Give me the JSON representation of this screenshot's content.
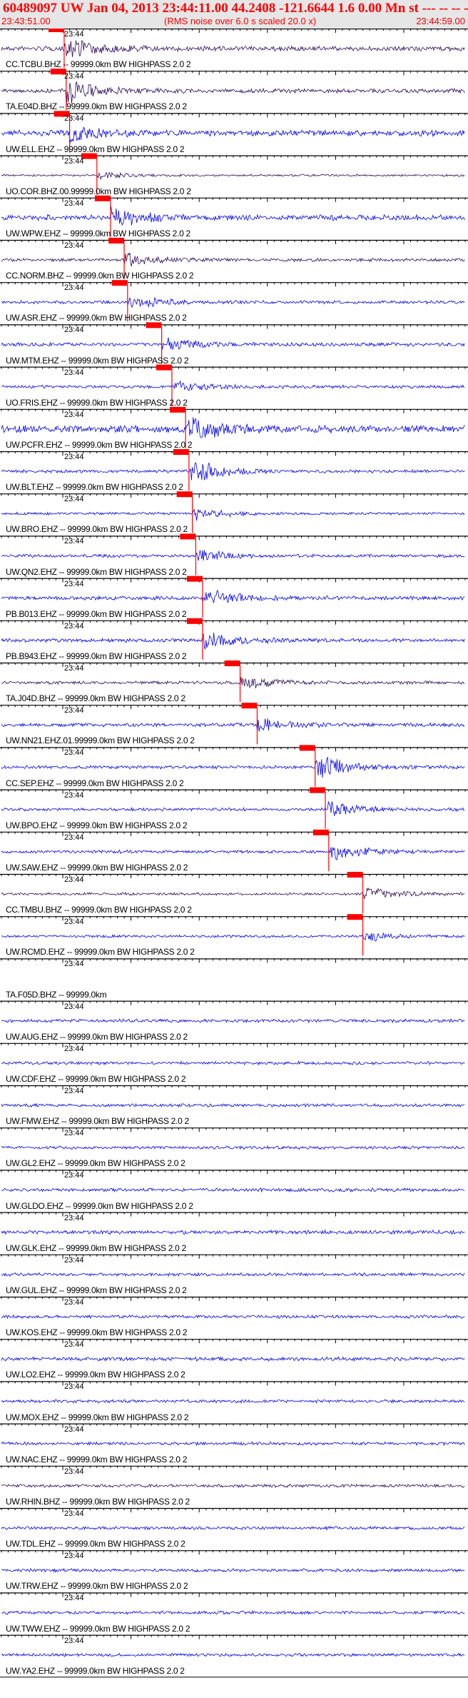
{
  "header": {
    "title": "60489097 UW Jan 04, 2013 23:44:11.00   44.2408 -121.6644  1.6 0.00 Mn st --- -- --   -1",
    "start_time": "23:43:51.00",
    "end_time": "23:44:59.00",
    "note": "(RMS noise over 6.0 s scaled 20.0 x)"
  },
  "chart_data": {
    "type": "line",
    "time_mark": "23:44",
    "duration_s": 68,
    "tick_interval_s": 1,
    "time_mark_s": 9,
    "colors": {
      "blue": "#0000ee",
      "dark": "#2a0a5a",
      "pick": "#ff0000",
      "axis": "#000000",
      "header_bg": "#e6e6e6"
    },
    "traces": [
      {
        "label": "CC.TCBU.BHZ -- 99999.0km BW  HIGHPASS  2.0  2",
        "color": "dark",
        "amp": 0.45,
        "pick_s": 9.2,
        "burst": 0.9
      },
      {
        "label": "TA.E04D.BHZ -- 99999.0km BW  HIGHPASS  2.0  2",
        "color": "dark",
        "amp": 0.4,
        "pick_s": 9.5,
        "burst": 0.9
      },
      {
        "label": "UW.ELL.EHZ -- 99999.0km BW  HIGHPASS  2.0  2",
        "color": "blue",
        "amp": 0.55,
        "pick_s": 10.0,
        "burst": 0.7
      },
      {
        "label": "UO.COR.BHZ.00.99999.0km BW  HIGHPASS  2.0  2",
        "color": "dark",
        "amp": 0.2,
        "pick_s": 14.0,
        "burst": 0.3
      },
      {
        "label": "UW.WPW.EHZ -- 99999.0km BW  HIGHPASS  2.0  2",
        "color": "blue",
        "amp": 0.5,
        "pick_s": 16.0,
        "burst": 0.9
      },
      {
        "label": "CC.NORM.BHZ -- 99999.0km BW  HIGHPASS  2.0  2",
        "color": "dark",
        "amp": 0.3,
        "pick_s": 18.0,
        "burst": 0.6
      },
      {
        "label": "UW.ASR.EHZ -- 99999.0km BW  HIGHPASS  2.0  2",
        "color": "blue",
        "amp": 0.3,
        "pick_s": 18.5,
        "burst": 0.6
      },
      {
        "label": "UW.MTM.EHZ -- 99999.0km BW  HIGHPASS  2.0  2",
        "color": "blue",
        "amp": 0.35,
        "pick_s": 23.5,
        "burst": 0.6
      },
      {
        "label": "UO.FRIS.EHZ -- 99999.0km BW  HIGHPASS  2.0  2",
        "color": "blue",
        "amp": 0.3,
        "pick_s": 25.0,
        "burst": 0.5
      },
      {
        "label": "UW.PCFR.EHZ -- 99999.0km BW  HIGHPASS  2.0  2",
        "color": "blue",
        "amp": 0.7,
        "pick_s": 27.0,
        "burst": 1.0
      },
      {
        "label": "UW.BLT.EHZ -- 99999.0km BW  HIGHPASS  2.0  2",
        "color": "blue",
        "amp": 0.3,
        "pick_s": 27.5,
        "burst": 1.0
      },
      {
        "label": "UW.BRO.EHZ -- 99999.0km BW  HIGHPASS  2.0  2",
        "color": "blue",
        "amp": 0.25,
        "pick_s": 28.0,
        "burst": 0.5
      },
      {
        "label": "UW.QN2.EHZ -- 99999.0km BW  HIGHPASS  2.0  2",
        "color": "blue",
        "amp": 0.3,
        "pick_s": 28.5,
        "burst": 0.5
      },
      {
        "label": "PB.B013.EHZ -- 99999.0km BW  HIGHPASS  2.0  2",
        "color": "blue",
        "amp": 0.35,
        "pick_s": 29.5,
        "burst": 0.8
      },
      {
        "label": "PB.B943.EHZ -- 99999.0km BW  HIGHPASS  2.0  2",
        "color": "blue",
        "amp": 0.35,
        "pick_s": 29.5,
        "burst": 0.8
      },
      {
        "label": "TA.J04D.BHZ -- 99999.0km BW  HIGHPASS  2.0  2",
        "color": "dark",
        "amp": 0.3,
        "pick_s": 35.0,
        "burst": 0.6
      },
      {
        "label": "UW.NN21.EHZ.01.99999.0km BW  HIGHPASS  2.0  2",
        "color": "blue",
        "amp": 0.35,
        "pick_s": 37.5,
        "burst": 0.5
      },
      {
        "label": "CC.SEP.EHZ -- 99999.0km BW  HIGHPASS  2.0  2",
        "color": "blue",
        "amp": 0.3,
        "pick_s": 46.0,
        "burst": 1.0
      },
      {
        "label": "UW.BPO.EHZ -- 99999.0km BW  HIGHPASS  2.0  2",
        "color": "blue",
        "amp": 0.3,
        "pick_s": 47.5,
        "burst": 0.6
      },
      {
        "label": "UW.SAW.EHZ -- 99999.0km BW  HIGHPASS  2.0  2",
        "color": "blue",
        "amp": 0.3,
        "pick_s": 48.0,
        "burst": 0.7
      },
      {
        "label": "CC.TMBU.BHZ -- 99999.0km BW  HIGHPASS  2.0  2",
        "color": "dark",
        "amp": 0.25,
        "pick_s": 53.0,
        "burst": 0.6
      },
      {
        "label": "UW.RCMD.EHZ -- 99999.0km BW  HIGHPASS  2.0  2",
        "color": "blue",
        "amp": 0.25,
        "pick_s": 53.0,
        "burst": 0.4
      },
      {
        "label": "TA.F05D.BHZ -- 99999.0km",
        "color": "dark",
        "amp": 0.0,
        "pick_s": null,
        "burst": 0.0
      },
      {
        "label": "UW.AUG.EHZ -- 99999.0km BW  HIGHPASS  2.0  2",
        "color": "blue",
        "amp": 0.3,
        "pick_s": null,
        "burst": 0.0
      },
      {
        "label": "UW.CDF.EHZ -- 99999.0km BW  HIGHPASS  2.0  2",
        "color": "blue",
        "amp": 0.3,
        "pick_s": null,
        "burst": 0.0
      },
      {
        "label": "UW.FMW.EHZ -- 99999.0km BW  HIGHPASS  2.0  2",
        "color": "blue",
        "amp": 0.3,
        "pick_s": null,
        "burst": 0.0
      },
      {
        "label": "UW.GL2.EHZ -- 99999.0km BW  HIGHPASS  2.0  2",
        "color": "blue",
        "amp": 0.3,
        "pick_s": null,
        "burst": 0.0
      },
      {
        "label": "UW.GLDO.EHZ -- 99999.0km BW  HIGHPASS  2.0  2",
        "color": "blue",
        "amp": 0.35,
        "pick_s": null,
        "burst": 0.0
      },
      {
        "label": "UW.GLK.EHZ -- 99999.0km BW  HIGHPASS  2.0  2",
        "color": "blue",
        "amp": 0.35,
        "pick_s": null,
        "burst": 0.0
      },
      {
        "label": "UW.GUL.EHZ -- 99999.0km BW  HIGHPASS  2.0  2",
        "color": "blue",
        "amp": 0.3,
        "pick_s": null,
        "burst": 0.0
      },
      {
        "label": "UW.KOS.EHZ -- 99999.0km BW  HIGHPASS  2.0  2",
        "color": "blue",
        "amp": 0.3,
        "pick_s": null,
        "burst": 0.0
      },
      {
        "label": "UW.LO2.EHZ -- 99999.0km BW  HIGHPASS  2.0  2",
        "color": "blue",
        "amp": 0.35,
        "pick_s": null,
        "burst": 0.0
      },
      {
        "label": "UW.MOX.EHZ -- 99999.0km BW  HIGHPASS  2.0  2",
        "color": "blue",
        "amp": 0.3,
        "pick_s": null,
        "burst": 0.0
      },
      {
        "label": "UW.NAC.EHZ -- 99999.0km BW  HIGHPASS  2.0  2",
        "color": "blue",
        "amp": 0.3,
        "pick_s": null,
        "burst": 0.0
      },
      {
        "label": "UW.RHIN.BHZ -- 99999.0km BW  HIGHPASS  2.0  2",
        "color": "dark",
        "amp": 0.3,
        "pick_s": null,
        "burst": 0.0
      },
      {
        "label": "UW.TDL.EHZ -- 99999.0km BW  HIGHPASS  2.0  2",
        "color": "blue",
        "amp": 0.3,
        "pick_s": null,
        "burst": 0.0
      },
      {
        "label": "UW.TRW.EHZ -- 99999.0km BW  HIGHPASS  2.0  2",
        "color": "blue",
        "amp": 0.3,
        "pick_s": null,
        "burst": 0.0
      },
      {
        "label": "UW.TWW.EHZ -- 99999.0km BW  HIGHPASS  2.0  2",
        "color": "blue",
        "amp": 0.3,
        "pick_s": null,
        "burst": 0.0
      },
      {
        "label": "UW.YA2.EHZ -- 99999.0km BW  HIGHPASS  2.0  2",
        "color": "blue",
        "amp": 0.3,
        "pick_s": null,
        "burst": 0.0
      }
    ]
  }
}
